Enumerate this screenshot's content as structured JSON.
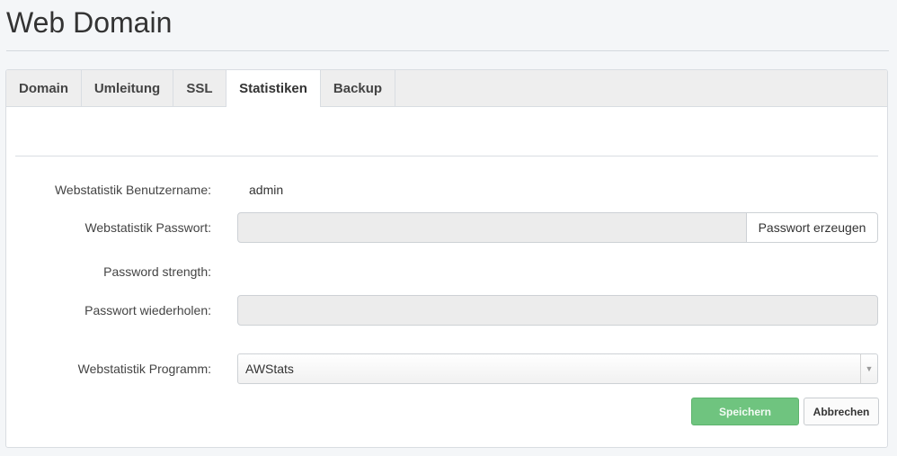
{
  "header": {
    "title": "Web Domain"
  },
  "tabs": [
    {
      "label": "Domain"
    },
    {
      "label": "Umleitung"
    },
    {
      "label": "SSL"
    },
    {
      "label": "Statistiken",
      "active": true
    },
    {
      "label": "Backup"
    }
  ],
  "form": {
    "username_label": "Webstatistik Benutzername:",
    "username_value": "admin",
    "password_label": "Webstatistik Passwort:",
    "password_value": "",
    "generate_label": "Passwort erzeugen",
    "strength_label": "Password strength:",
    "repeat_label": "Passwort wiederholen:",
    "repeat_value": "",
    "program_label": "Webstatistik Programm:",
    "program_value": "AWStats"
  },
  "actions": {
    "save_label": "Speichern",
    "cancel_label": "Abbrechen"
  },
  "colors": {
    "save_button": "#6fc47f",
    "background": "#f4f6f8"
  }
}
